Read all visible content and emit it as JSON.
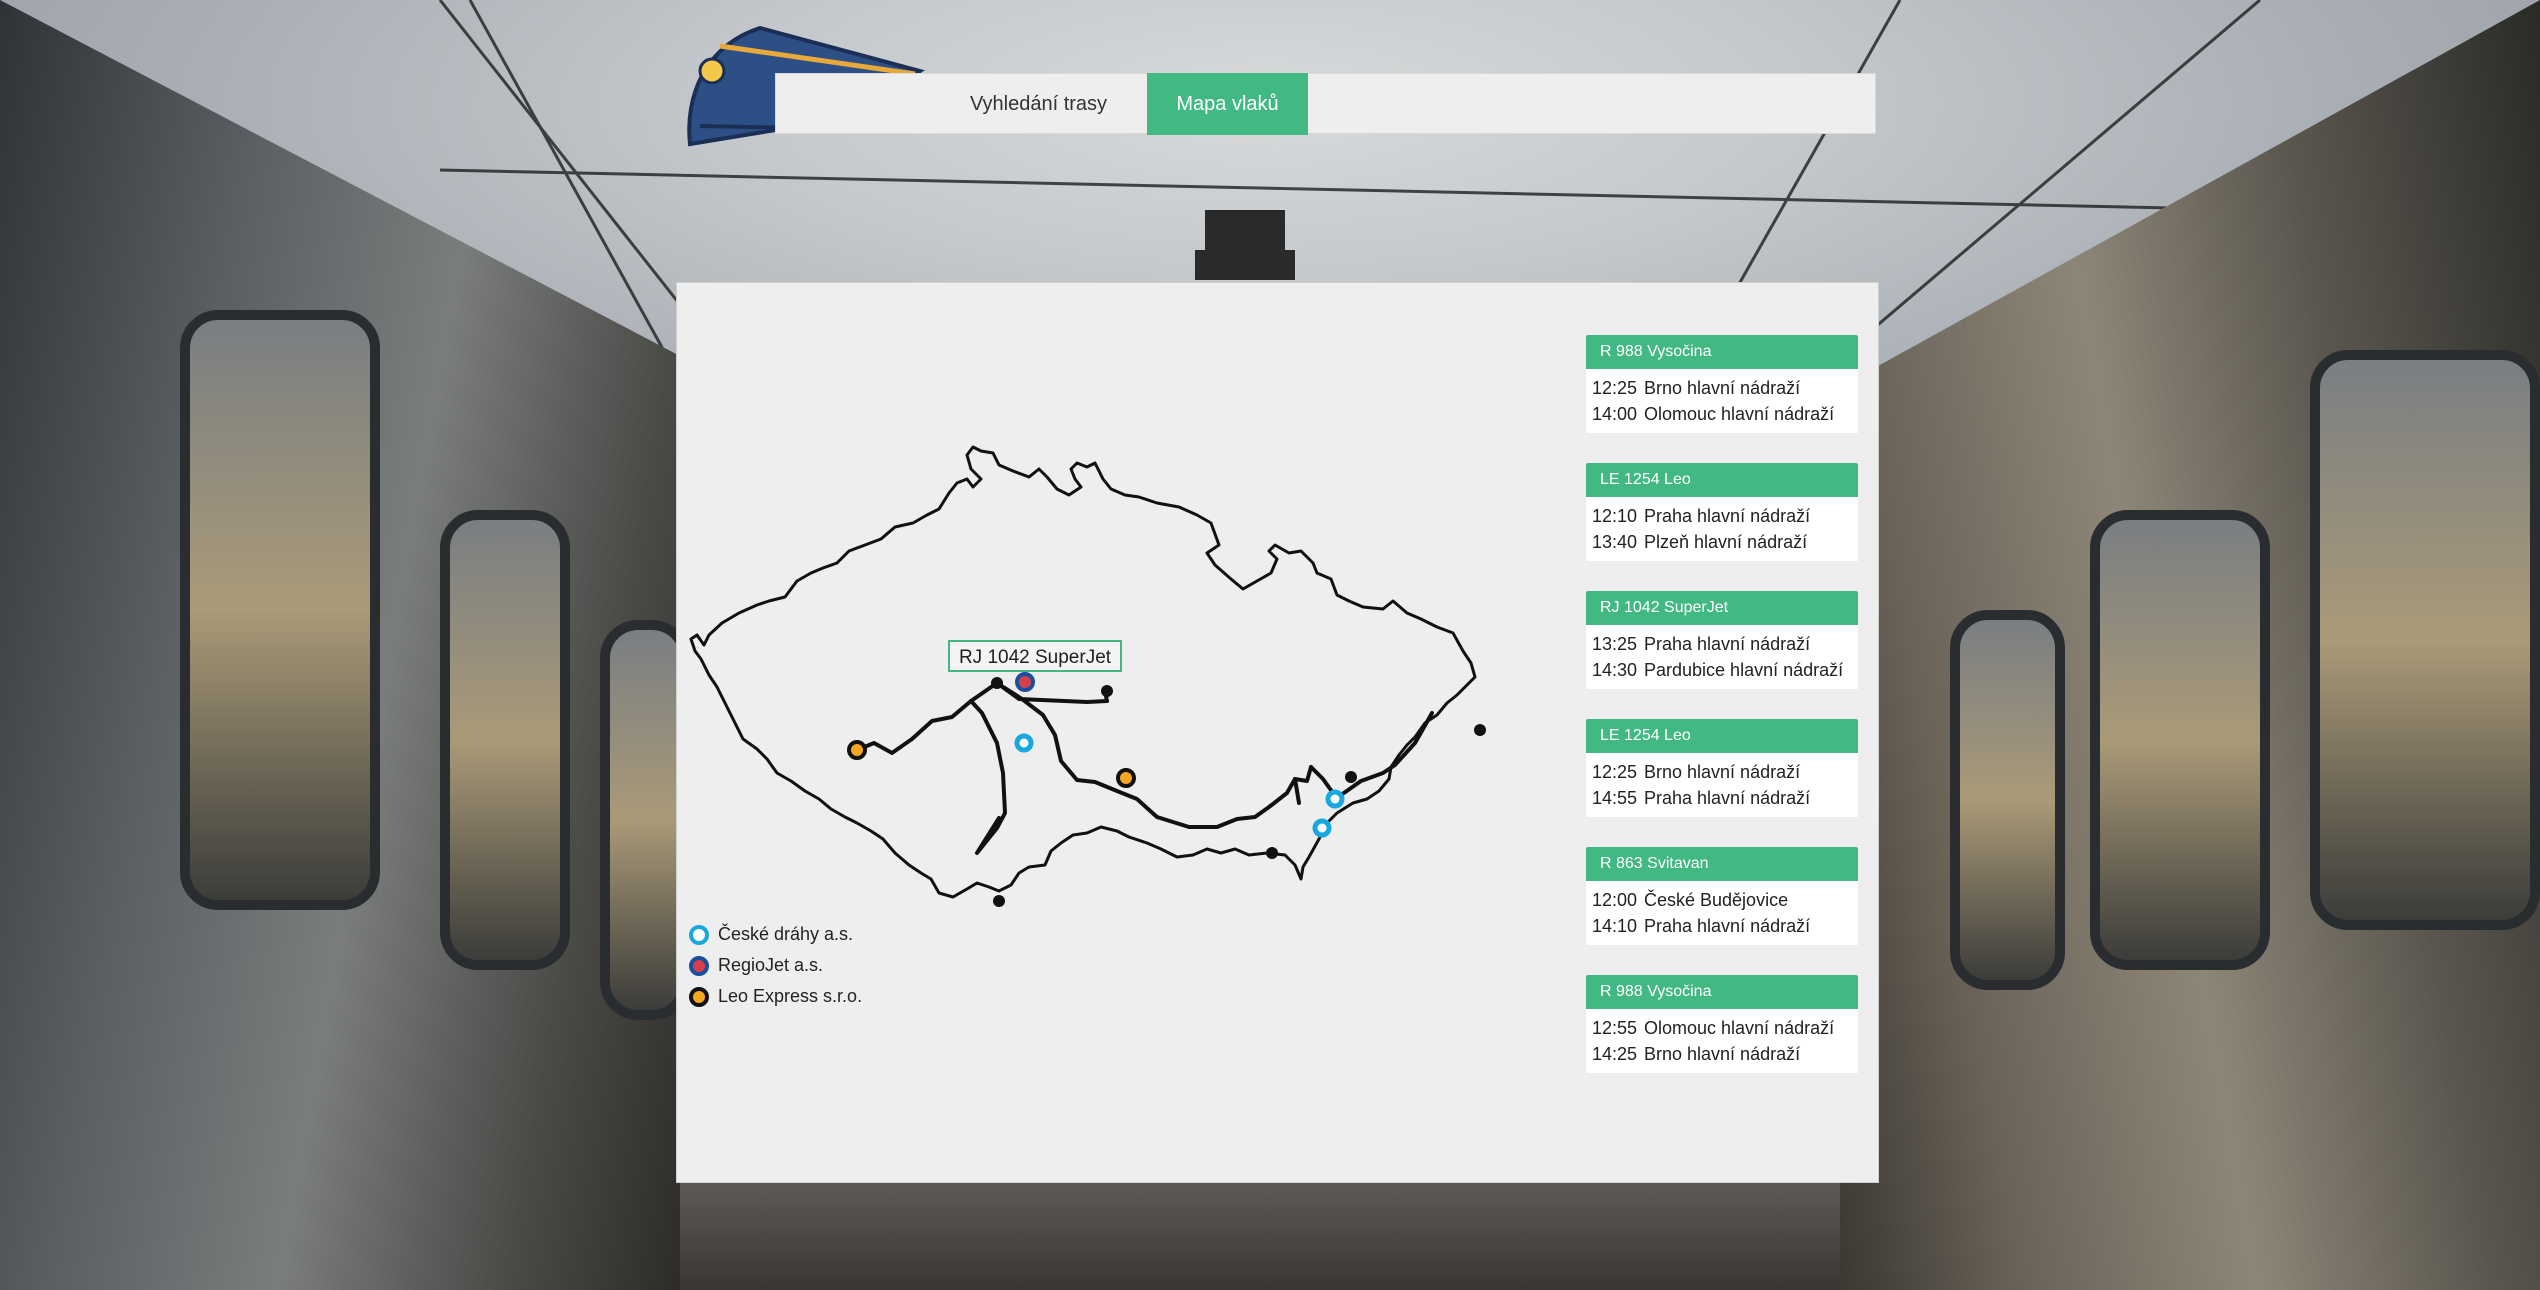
{
  "nav": {
    "route_search": "Vyhledání trasy",
    "train_map": "Mapa vlaků"
  },
  "map": {
    "tooltip": "RJ 1042 SuperJet"
  },
  "legend": [
    {
      "label": "České dráhy a.s.",
      "color": "#1aa7e0"
    },
    {
      "label": "RegioJet a.s.",
      "color": "#1a4fa0"
    },
    {
      "label": "Leo Express s.r.o.",
      "color": "#f5a623"
    }
  ],
  "colors": {
    "accent": "#42b883",
    "cd": "#1aa7e0",
    "regiojet": "#d6404a",
    "leo": "#f5a623"
  },
  "trains": [
    {
      "name": "R 988 Vysočina",
      "stops": [
        {
          "time": "12:25",
          "station": "Brno hlavní nádraží"
        },
        {
          "time": "14:00",
          "station": "Olomouc hlavní nádraží"
        }
      ]
    },
    {
      "name": "LE 1254 Leo",
      "stops": [
        {
          "time": "12:10",
          "station": "Praha hlavní nádraží"
        },
        {
          "time": "13:40",
          "station": "Plzeň hlavní nádraží"
        }
      ]
    },
    {
      "name": "RJ 1042 SuperJet",
      "stops": [
        {
          "time": "13:25",
          "station": "Praha hlavní nádraží"
        },
        {
          "time": "14:30",
          "station": "Pardubice hlavní nádraží"
        }
      ]
    },
    {
      "name": "LE 1254 Leo",
      "stops": [
        {
          "time": "12:25",
          "station": "Brno hlavní nádraží"
        },
        {
          "time": "14:55",
          "station": "Praha hlavní nádraží"
        }
      ]
    },
    {
      "name": "R 863 Svitavan",
      "stops": [
        {
          "time": "12:00",
          "station": "České Budějovice"
        },
        {
          "time": "14:10",
          "station": "Praha hlavní nádraží"
        }
      ]
    },
    {
      "name": "R 988 Vysočina",
      "stops": [
        {
          "time": "12:55",
          "station": "Olomouc hlavní nádraží"
        },
        {
          "time": "14:25",
          "station": "Brno hlavní nádraží"
        }
      ]
    }
  ]
}
